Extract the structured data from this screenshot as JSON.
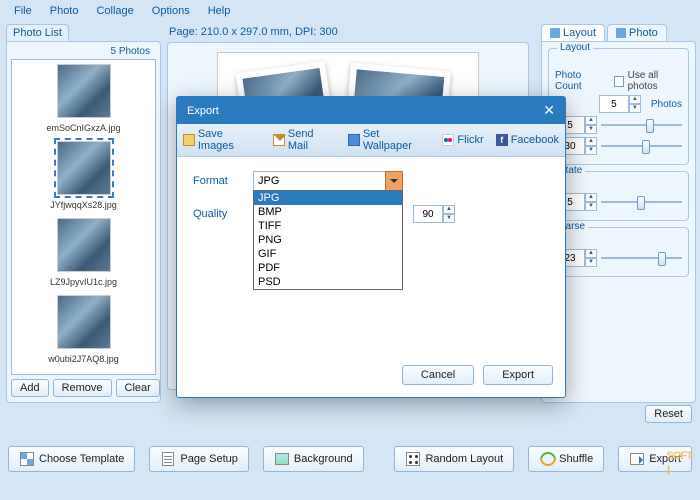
{
  "menu": {
    "items": [
      "File",
      "Photo",
      "Collage",
      "Options",
      "Help"
    ]
  },
  "photoList": {
    "title": "Photo List",
    "count_label": "5 Photos",
    "items": [
      {
        "file": "emSoCnIGxzA.jpg",
        "selected": false
      },
      {
        "file": "JYfjwqqXs28.jpg",
        "selected": true
      },
      {
        "file": "LZ9JpyvIU1c.jpg",
        "selected": false
      },
      {
        "file": "w0ubi2J7AQ8.jpg",
        "selected": false
      }
    ],
    "btn_add": "Add",
    "btn_remove": "Remove",
    "btn_clear": "Clear"
  },
  "pageInfo": "Page: 210.0 x 297.0 mm, DPI: 300",
  "rightPanel": {
    "tabs": {
      "layout": "Layout",
      "photo": "Photo"
    },
    "group_layout": {
      "title": "Layout",
      "photo_count_label": "Photo Count",
      "use_all": "Use all photos",
      "count_value": "5",
      "photos_suffix": "Photos",
      "row1_value": "5",
      "row2_value": "30"
    },
    "group_rotate": {
      "title": "otate",
      "value": "5"
    },
    "group_sparse": {
      "title": "parse",
      "value": "23"
    },
    "reset": "Reset"
  },
  "bottom": {
    "choose_template": "Choose Template",
    "page_setup": "Page Setup",
    "background": "Background",
    "random_layout": "Random Layout",
    "shuffle": "Shuffle",
    "export": "Export"
  },
  "modal": {
    "title": "Export",
    "toolbar": {
      "save_images": "Save Images",
      "send_mail": "Send Mail",
      "set_wallpaper": "Set Wallpaper",
      "flickr": "Flickr",
      "facebook": "Facebook"
    },
    "format_label": "Format",
    "format_value": "JPG",
    "format_options": [
      "JPG",
      "BMP",
      "TIFF",
      "PNG",
      "GIF",
      "PDF",
      "PSD"
    ],
    "quality_label": "Quality",
    "quality_value": "90",
    "btn_cancel": "Cancel",
    "btn_export": "Export"
  },
  "watermark": {
    "line1": "SOFT",
    "line2": "I"
  }
}
